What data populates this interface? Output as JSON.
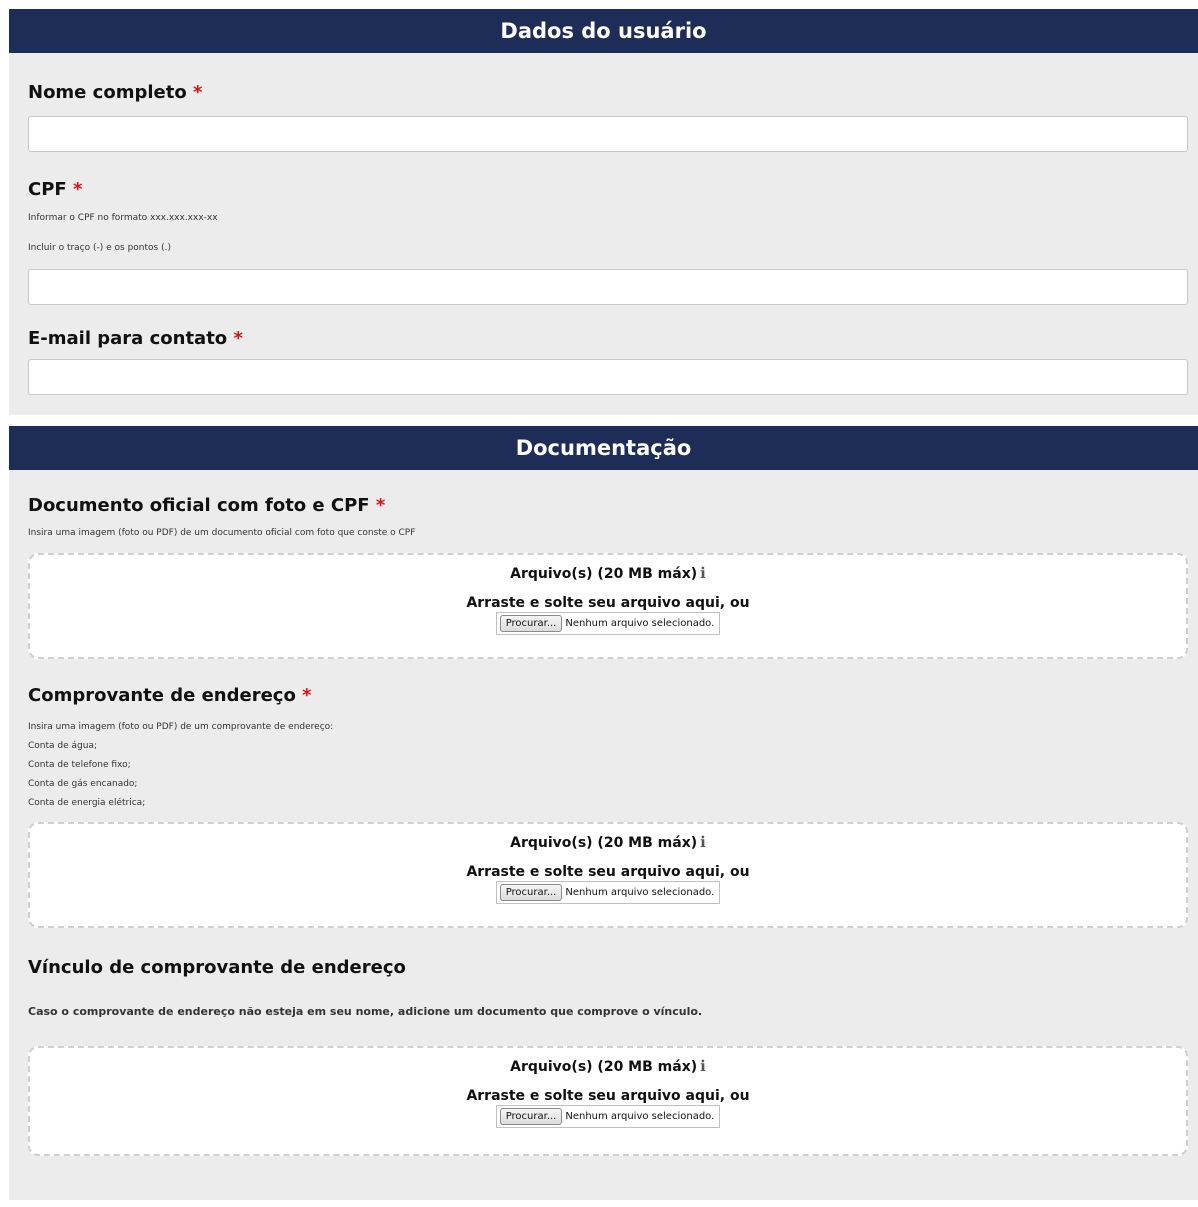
{
  "user_section": {
    "title": "Dados do usuário",
    "full_name": {
      "label": "Nome completo",
      "required_mark": "*",
      "value": ""
    },
    "cpf": {
      "label": "CPF",
      "required_mark": "*",
      "help_lines": [
        "Informar o CPF no formato xxx.xxx.xxx-xx",
        "Incluir o traço (-) e os pontos (.)"
      ],
      "value": ""
    },
    "email": {
      "label": "E-mail para contato",
      "required_mark": "*",
      "value": ""
    }
  },
  "documents_section": {
    "title": "Documentação",
    "photo_id": {
      "label": "Documento oficial com foto e CPF",
      "required_mark": "*",
      "help": "Insira uma imagem (foto ou PDF) de um documento oficial com foto que conste o CPF"
    },
    "address_proof": {
      "label": "Comprovante de endereço",
      "required_mark": "*",
      "help": "Insira uma imagem (foto ou PDF) de um comprovante de endereço:",
      "help_list": [
        "Conta de água;",
        "Conta de telefone fixo;",
        "Conta de gás encanado;",
        "Conta de energia elétrica;"
      ]
    },
    "address_link": {
      "label": "Vínculo de comprovante de endereço",
      "help": "Caso o comprovante de endereço não esteja em seu nome, adicione um documento que comprove o vínculo."
    }
  },
  "upload": {
    "title": "Arquivo(s) (20 MB máx)",
    "info_icon": "info-icon",
    "drag_text": "Arraste e solte seu arquivo aqui, ou",
    "browse_label": "Procurar...",
    "no_file_text": "Nenhum arquivo selecionado."
  },
  "colors": {
    "header_bg": "#1d2d58",
    "panel_bg": "#ececec",
    "required": "#e01010"
  }
}
